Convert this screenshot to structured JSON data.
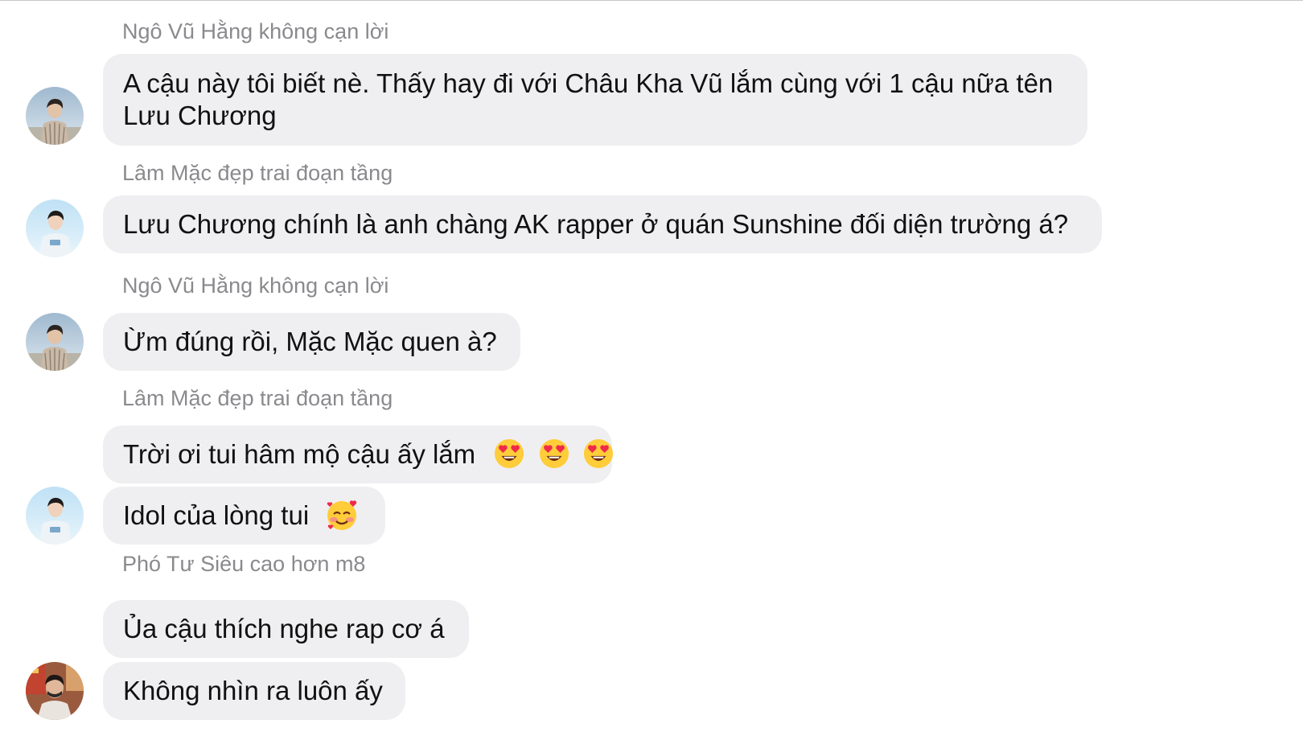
{
  "chat": {
    "messages": [
      {
        "sender": "Ngô Vũ Hằng không cạn lời",
        "text": "A cậu này tôi biết nè. Thấy hay đi với Châu Kha Vũ lắm cùng với 1 cậu nữa tên Lưu Chương",
        "avatar_icon": "avatar-hang-icon"
      },
      {
        "sender": "Lâm Mặc đẹp trai đoạn tầng",
        "text": "Lưu Chương chính là anh chàng AK rapper ở quán Sunshine đối diện trường á?",
        "avatar_icon": "avatar-mac-icon"
      },
      {
        "sender": "Ngô Vũ Hằng không cạn lời",
        "text": "Ừm đúng rồi, Mặc Mặc quen à?",
        "avatar_icon": "avatar-hang-icon"
      },
      {
        "sender": "Lâm Mặc đẹp trai đoạn tầng",
        "text": "Trời ơi tui hâm mộ cậu ấy lắm",
        "emoji_icons": [
          "heart-eyes-emoji-icon",
          "heart-eyes-emoji-icon",
          "heart-eyes-emoji-icon"
        ],
        "avatar_icon": "avatar-mac-icon"
      },
      {
        "text": "Idol của lòng tui",
        "emoji_icons": [
          "smiling-face-with-hearts-emoji-icon"
        ]
      },
      {
        "sender": "Phó Tư Siêu cao hơn m8",
        "text": "Ủa cậu thích nghe rap cơ á",
        "avatar_icon": "avatar-sieu-icon"
      },
      {
        "text": "Không nhìn ra luôn ấy"
      }
    ]
  },
  "colors": {
    "bubble_bg": "#efeff1",
    "sender_text": "#8a8a8e",
    "message_text": "#111111",
    "background": "#ffffff"
  }
}
